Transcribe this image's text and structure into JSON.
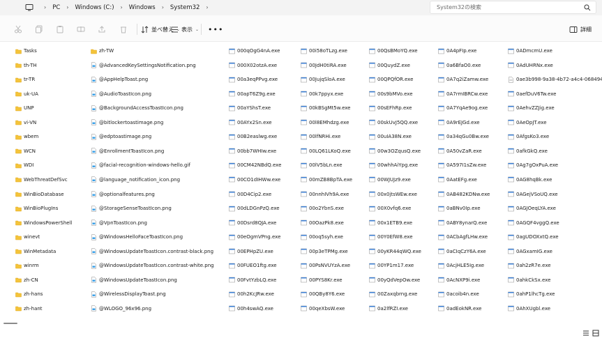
{
  "address": {
    "crumbs": [
      "PC",
      "Windows (C:)",
      "Windows",
      "System32"
    ],
    "search_placeholder": "System32の検索"
  },
  "toolbar": {
    "sort_label": "並べ替え",
    "view_label": "表示",
    "details_label": "詳細"
  },
  "columns": [
    {
      "type": "folder",
      "items": [
        "Tasks",
        "th-TH",
        "tr-TR",
        "uk-UA",
        "UNP",
        "vi-VN",
        "wbem",
        "WCN",
        "WDI",
        "WebThreatDefSvc",
        "WinBioDatabase",
        "WinBioPlugIns",
        "WindowsPowerShell",
        "winevt",
        "WinMetadata",
        "winrm",
        "zh-CN",
        "zh-hans",
        "zh-hant"
      ]
    },
    {
      "type": "mixed",
      "items": [
        {
          "name": "zh-TW",
          "kind": "folder"
        },
        {
          "name": "@AdvancedKeySettingsNotification.png",
          "kind": "file"
        },
        {
          "name": "@AppHelpToast.png",
          "kind": "file"
        },
        {
          "name": "@AudioToastIcon.png",
          "kind": "file"
        },
        {
          "name": "@BackgroundAccessToastIcon.png",
          "kind": "file"
        },
        {
          "name": "@bitlockertoastimage.png",
          "kind": "file"
        },
        {
          "name": "@edptoastimage.png",
          "kind": "file"
        },
        {
          "name": "@EnrollmentToastIcon.png",
          "kind": "file"
        },
        {
          "name": "@facial-recognition-windows-hello.gif",
          "kind": "file"
        },
        {
          "name": "@language_notification_icon.png",
          "kind": "file"
        },
        {
          "name": "@optionalfeatures.png",
          "kind": "file"
        },
        {
          "name": "@StorageSenseToastIcon.png",
          "kind": "file"
        },
        {
          "name": "@VpnToastIcon.png",
          "kind": "file"
        },
        {
          "name": "@WindowsHelloFaceToastIcon.png",
          "kind": "file"
        },
        {
          "name": "@WindowsUpdateToastIcon.contrast-black.png",
          "kind": "file"
        },
        {
          "name": "@WindowsUpdateToastIcon.contrast-white.png",
          "kind": "file"
        },
        {
          "name": "@WindowsUpdateToastIcon.png",
          "kind": "file"
        },
        {
          "name": "@WirelessDisplayToast.png",
          "kind": "file"
        },
        {
          "name": "@WLOGO_96x96.png",
          "kind": "file"
        }
      ]
    },
    {
      "type": "exe",
      "items": [
        "000qOgG4nA.exe",
        "000X02otzA.exe",
        "00a3eqPPvg.exe",
        "00apT6Z9g.exe",
        "00aYShsT.exe",
        "00AYx2Sn.exe",
        "00B2easlwg.exe",
        "00bb7WHIw.exe",
        "00CM42NBdQ.exe",
        "00CO1dIHWw.exe",
        "00D4Cip2.exe",
        "00dLDGnPzQ.exe",
        "00Dsrd8QJA.exe",
        "00eOgmVPng.exe",
        "00EPHpZU.exe",
        "00FUEO1ftg.exe",
        "00FvtYzbLQ.exe",
        "00h2KcJRw.exe",
        "00h4swAQ.exe"
      ]
    },
    {
      "type": "exe",
      "items": [
        "00i58oTLzg.exe",
        "00JdH0tiRA.exe",
        "00JujqSloA.exe",
        "00k7ppyx.exe",
        "00kBSgMt5w.exe",
        "00l8EMhdzg.exe",
        "00lfNRHi.exe",
        "00LQ61LKoQ.exe",
        "00lV5bLn.exe",
        "00mZB8BpTA.exe",
        "00nnhIVh9A.exe",
        "00o2YbnS.exe",
        "00OazPk8.exe",
        "00oq5syh.exe",
        "00p3eTPMg.exe",
        "00PsNVUYzA.exe",
        "00PYS8Kr.exe",
        "00QBy8Y6.exe",
        "00qeXbsW.exe"
      ]
    },
    {
      "type": "exe",
      "items": [
        "00QsBMoYQ.exe",
        "00QuydZ.exe",
        "00QPQfOR.exe",
        "00s9bMVo.exe",
        "00sEFhRp.exe",
        "00skUvJ5QQ.exe",
        "00uIA38N.exe",
        "00w3OZqusQ.exe",
        "00whhAiYpg.exe",
        "00WJUJz9.exe",
        "00x0jtsWEw.exe",
        "00X0vfq6.exe",
        "00x1ETB9.exe",
        "00Y0EfW8.exe",
        "00yKR44qWQ.exe",
        "00YP1m17.exe",
        "00yQdVepOw.exe",
        "00Zaxqbrng.exe",
        "0a2lfRZI.exe"
      ]
    },
    {
      "type": "exe",
      "items": [
        "0A4pFIp.exe",
        "0a6BfaO0.exe",
        "0A7q2iZamw.exe",
        "0A7rmIBRCw.exe",
        "0A7YqAe9og.exe",
        "0A9rEJGd.exe",
        "0a34qGu0Bw.exe",
        "0A50vZaR.exe",
        "0A597I1sZw.exe",
        "0AatEFg.exe",
        "0AB482KDNw.exe",
        "0aBNv0Ip.exe",
        "0ABY8ynarQ.exe",
        "0ACbAgfLHw.exe",
        "0aCIqCzY6A.exe",
        "0AcjHLE5Ig.exe",
        "0AcNXP9i.exe",
        "0acoib4n.exe",
        "0adEokNR.exe"
      ]
    },
    {
      "type": "mixed2",
      "items": [
        {
          "name": "0ADmcmU.exe",
          "kind": "exe"
        },
        {
          "name": "0AdUHRNx.exe",
          "kind": "exe"
        },
        {
          "name": "0ae3b998-9a38-4b72-a4c4-06849441",
          "kind": "doc"
        },
        {
          "name": "0aefDuV6Tw.exe",
          "kind": "exe"
        },
        {
          "name": "0AehvZZJig.exe",
          "kind": "exe"
        },
        {
          "name": "0AeOpJT.exe",
          "kind": "exe"
        },
        {
          "name": "0AfgsKo3.exe",
          "kind": "exe"
        },
        {
          "name": "0afkGkQ.exe",
          "kind": "exe"
        },
        {
          "name": "0Ag7gOxPuA.exe",
          "kind": "exe"
        },
        {
          "name": "0AG8hqBk.exe",
          "kind": "exe"
        },
        {
          "name": "0AGejVSoUQ.exe",
          "kind": "exe"
        },
        {
          "name": "0AGJOeqLYA.exe",
          "kind": "exe"
        },
        {
          "name": "0AGQF4vggQ.exe",
          "kind": "exe"
        },
        {
          "name": "0agUDOXxtQ.exe",
          "kind": "exe"
        },
        {
          "name": "0AGxamIG.exe",
          "kind": "exe"
        },
        {
          "name": "0ah2zR7e.exe",
          "kind": "exe"
        },
        {
          "name": "0ahkCkSx.exe",
          "kind": "exe"
        },
        {
          "name": "0ahP1lhcTg.exe",
          "kind": "exe"
        },
        {
          "name": "0AhXUgbl.exe",
          "kind": "exe"
        }
      ]
    }
  ],
  "colors": {
    "folder": "#f4c43b",
    "folder_dark": "#e0a719",
    "exe_blue": "#3b7fd4",
    "address_bg": "#f3f3f3",
    "toolbar_bg": "#fbfbfb"
  }
}
